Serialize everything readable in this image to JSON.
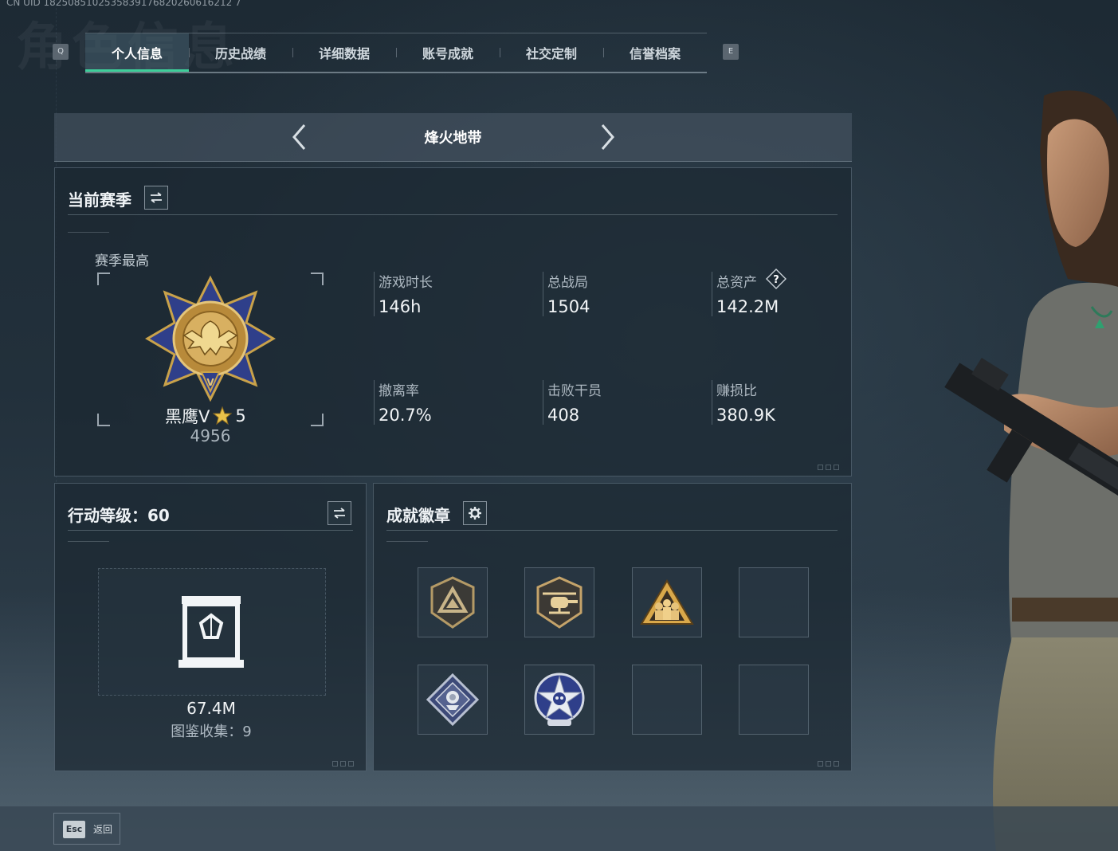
{
  "uid_line": "CN UID 1825085102535839176820260616212 7",
  "bg_watermark": "角色信息",
  "tabs": {
    "prev_key": "Q",
    "next_key": "E",
    "items": [
      "个人信息",
      "历史战绩",
      "详细数据",
      "账号成就",
      "社交定制",
      "信誉档案"
    ],
    "active_index": 0
  },
  "mode": {
    "title": "烽火地带"
  },
  "season": {
    "title": "当前赛季",
    "best_label": "赛季最高",
    "rank_name": "黑鹰V",
    "rank_stars": "5",
    "rank_score": "4956",
    "stats": [
      {
        "label": "游戏时长",
        "value": "146h"
      },
      {
        "label": "总战局",
        "value": "1504"
      },
      {
        "label": "总资产",
        "value": "142.2M",
        "help": "?"
      },
      {
        "label": "撤离率",
        "value": "20.7%"
      },
      {
        "label": "击败干员",
        "value": "408"
      },
      {
        "label": "赚损比",
        "value": "380.9K"
      }
    ]
  },
  "action_level": {
    "title": "行动等级：60",
    "value": "67.4M",
    "collection": "图鉴收集：9"
  },
  "achievements": {
    "title": "成就徽章",
    "badges": [
      {
        "icon": "triangle-shield-badge-icon",
        "filled": true
      },
      {
        "icon": "helicopter-badge-icon",
        "filled": true
      },
      {
        "icon": "squad-triangle-badge-icon",
        "filled": true
      },
      {
        "icon": "",
        "filled": false
      },
      {
        "icon": "rose-diamond-badge-icon",
        "filled": true
      },
      {
        "icon": "skull-star-badge-icon",
        "filled": true
      },
      {
        "icon": "",
        "filled": false
      },
      {
        "icon": "",
        "filled": false
      }
    ]
  },
  "footer": {
    "esc_key": "Esc",
    "esc_label": "返回"
  },
  "colors": {
    "accent": "#3ecf9a",
    "gold": "#c9a24a",
    "navy": "#2f3f8a"
  }
}
